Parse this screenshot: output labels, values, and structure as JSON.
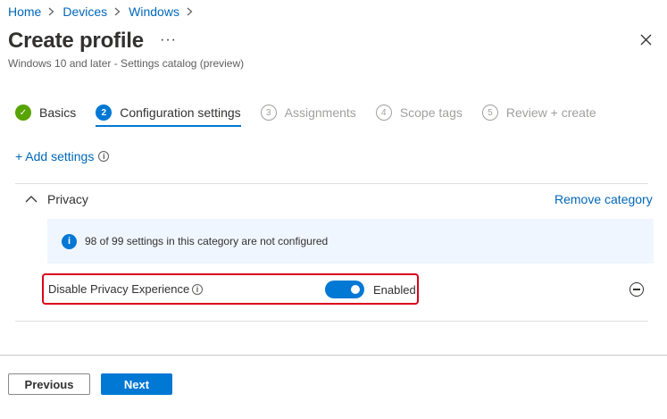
{
  "breadcrumb": [
    {
      "label": "Home"
    },
    {
      "label": "Devices"
    },
    {
      "label": "Windows"
    }
  ],
  "header": {
    "title": "Create profile",
    "more": "···",
    "subtitle": "Windows 10 and later - Settings catalog (preview)"
  },
  "steps": [
    {
      "num": "✓",
      "label": "Basics",
      "state": "done"
    },
    {
      "num": "2",
      "label": "Configuration settings",
      "state": "current"
    },
    {
      "num": "3",
      "label": "Assignments",
      "state": "pending"
    },
    {
      "num": "4",
      "label": "Scope tags",
      "state": "pending"
    },
    {
      "num": "5",
      "label": "Review + create",
      "state": "pending"
    }
  ],
  "add_settings": {
    "label": "+ Add settings",
    "info": "i"
  },
  "category": {
    "name": "Privacy",
    "remove_label": "Remove category",
    "banner_icon": "i",
    "banner_text": "98 of 99 settings in this category are not configured",
    "setting": {
      "name": "Disable Privacy Experience",
      "info": "i",
      "toggle_on": true,
      "toggle_text": "Enabled"
    }
  },
  "footer": {
    "previous_label": "Previous",
    "next_label": "Next"
  },
  "colors": {
    "accent": "#0078d4",
    "link": "#0067b8",
    "success": "#57a300",
    "highlight": "#d9001b"
  }
}
